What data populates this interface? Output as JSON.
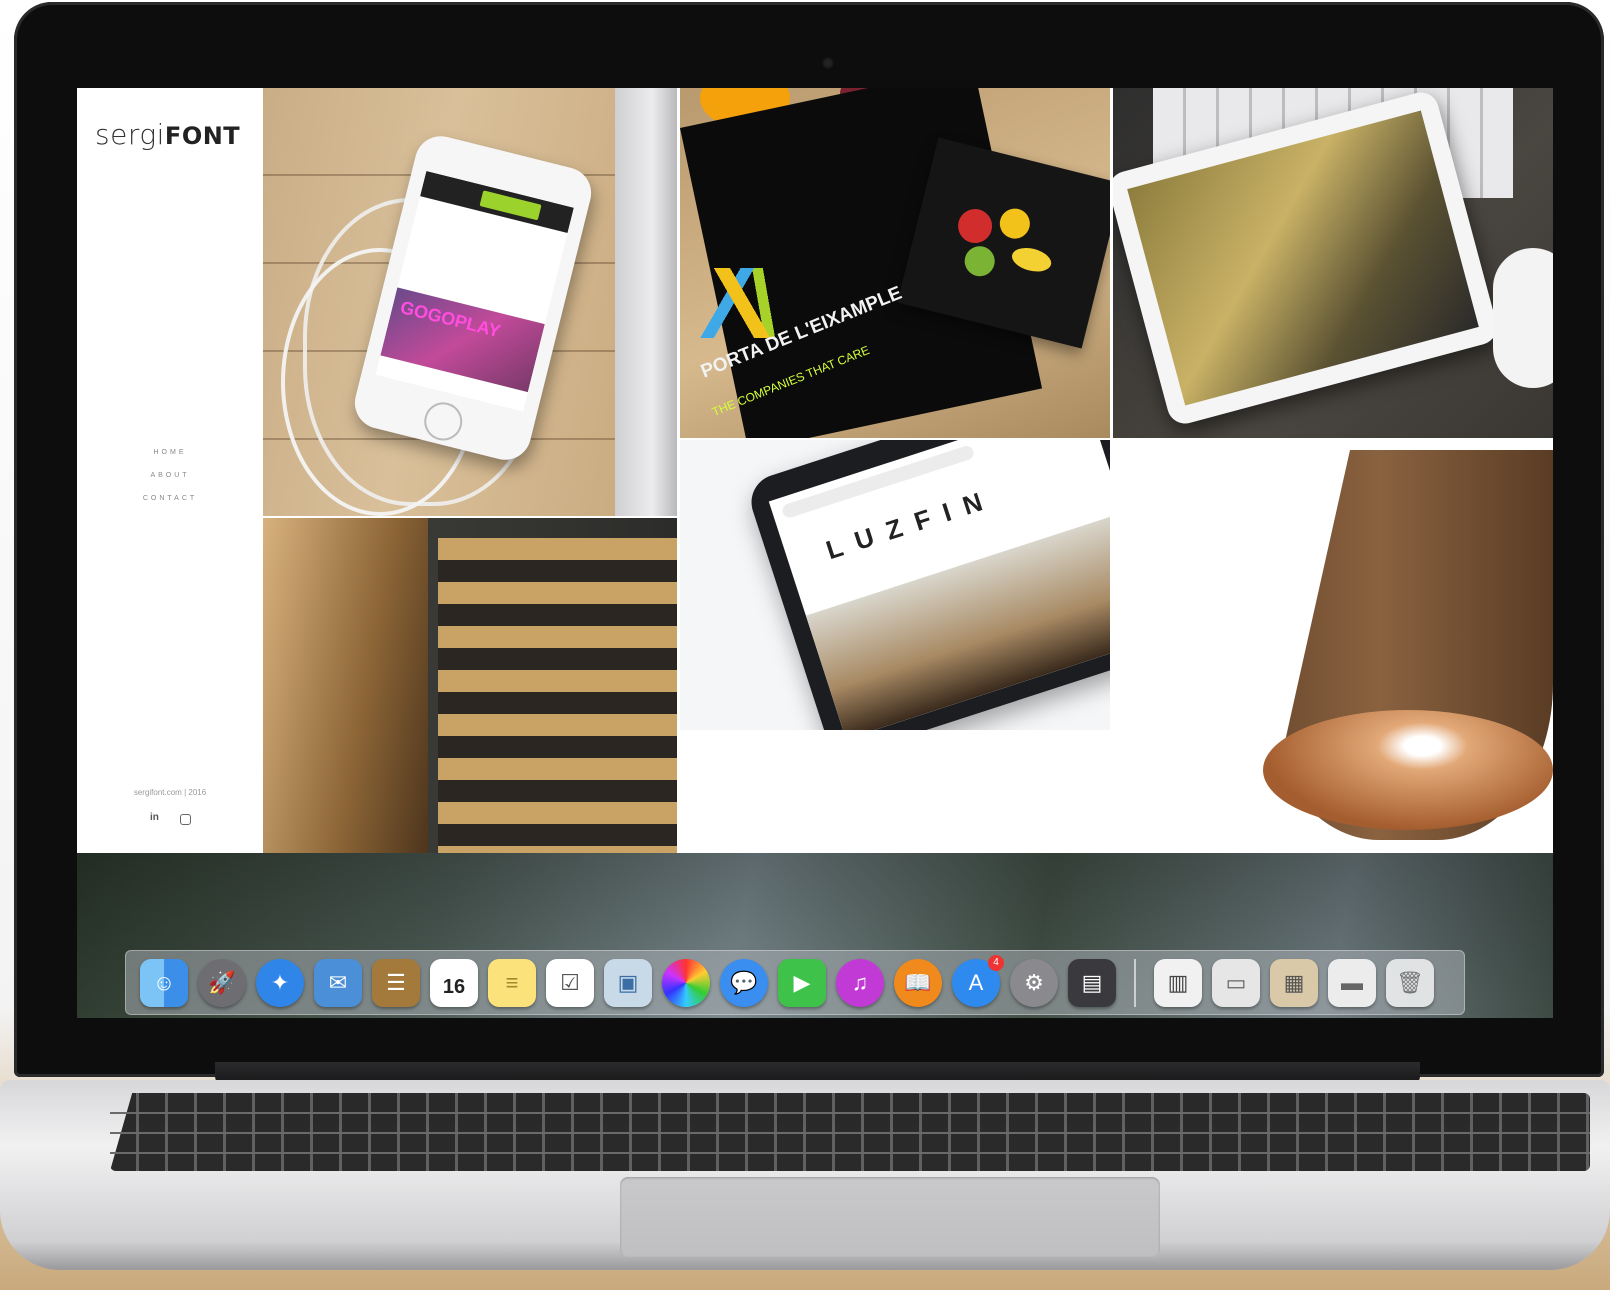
{
  "site": {
    "logo_light": "sergi",
    "logo_bold": "FONT",
    "nav": [
      "HOME",
      "ABOUT",
      "CONTACT"
    ],
    "footer_copy": "sergifont.com | 2016",
    "social": [
      "in",
      "instagram"
    ]
  },
  "portfolio": {
    "tiles": [
      {
        "name": "gogoplay-app",
        "text": "GOGOPLAY"
      },
      {
        "name": "porta-eixample",
        "title": "PORTA DE L'EIXAMPLE",
        "subtitle": "THE COMPANIES THAT CARE"
      },
      {
        "name": "motorbike-tablet"
      },
      {
        "name": "eyeglass-editorial"
      },
      {
        "name": "luzfin-web",
        "url": "www.luzfin.com",
        "title": "LUZFIN"
      },
      {
        "name": "wood-lamp"
      }
    ]
  },
  "dock": {
    "calendar_day": "16",
    "app_store_badge": "4",
    "apps": [
      "finder",
      "launchpad",
      "safari",
      "mail",
      "contacts",
      "calendar",
      "notes",
      "reminders",
      "preview",
      "photos",
      "messages",
      "facetime",
      "itunes",
      "ibooks",
      "app-store",
      "system-preferences",
      "screen",
      "documents",
      "files",
      "finder-window",
      "folder",
      "trash"
    ]
  },
  "colors": {
    "accent_green": "#9bd22c",
    "brand_lime": "#d4ff3a",
    "badge_red": "#e33"
  }
}
